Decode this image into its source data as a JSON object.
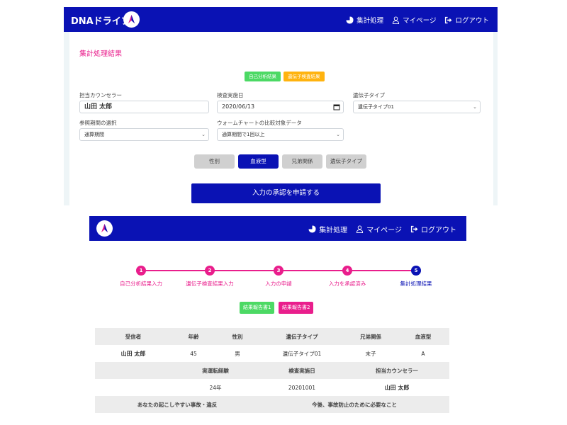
{
  "top": {
    "brand": "DNAドライブ",
    "nav": [
      "集計処理",
      "マイページ",
      "ログアウト"
    ],
    "section_title": "集計処理結果",
    "tags": [
      "自己分析結果",
      "遺伝子検査結果"
    ],
    "fields": {
      "counselor": {
        "label": "担当カウンセラー",
        "value": "山田 太郎"
      },
      "test_date": {
        "label": "検査実施日",
        "value": "2020/06/13"
      },
      "gene_type": {
        "label": "遺伝子タイプ",
        "value": "遺伝子タイプ01"
      },
      "ref_period": {
        "label": "参照期間の選択",
        "value": "通算期間"
      },
      "warm_chart": {
        "label": "ウォームチャートの比較対象データ",
        "value": "通算期間で1回以上"
      }
    },
    "filters": [
      "性別",
      "血液型",
      "兄弟関係",
      "遺伝子タイプ"
    ],
    "active_filter": "血液型",
    "submit": "入力の承認を申請する"
  },
  "bottom": {
    "nav": [
      "集計処理",
      "マイページ",
      "ログアウト"
    ],
    "steps": [
      {
        "num": "1",
        "label": "自己分析結果入力"
      },
      {
        "num": "2",
        "label": "遺伝子検査結果入力"
      },
      {
        "num": "3",
        "label": "入力の申請"
      },
      {
        "num": "4",
        "label": "入力を承認済み"
      },
      {
        "num": "5",
        "label": "集計処理結果"
      }
    ],
    "report_tags": [
      "結果報告書1",
      "結果報告書2"
    ],
    "table": {
      "header1": [
        "受信者",
        "年齢",
        "性別",
        "遺伝子タイプ",
        "兄弟関係",
        "血液型"
      ],
      "row1": [
        "山田 太郎",
        "45",
        "男",
        "遺伝子タイプ01",
        "末子",
        "A"
      ],
      "header2": [
        "実運転経験",
        "検査実施日",
        "担当カウンセラー"
      ],
      "row2": [
        "24年",
        "20201001",
        "山田 太郎"
      ],
      "header3": [
        "あなたの起こしやすい事故・違反",
        "今後、事故防止のために必要なこと"
      ]
    }
  },
  "colors": {
    "primary": "#0a12b4",
    "accent": "#e91e8c",
    "green": "#4cd964",
    "orange": "#ffb30f"
  }
}
